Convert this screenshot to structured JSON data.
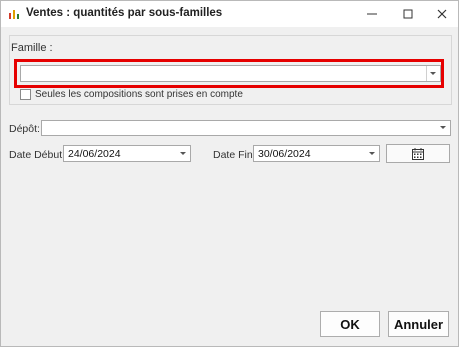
{
  "window": {
    "title": "Ventes : quantités par sous-familles",
    "icon": "bar-chart-icon",
    "controls": [
      "minimize",
      "maximize",
      "close"
    ]
  },
  "famille": {
    "label": "Famille :",
    "value": "",
    "highlight_color": "#e60000"
  },
  "compositions": {
    "label": "Seules les compositions sont prises en compte",
    "checked": false
  },
  "depot": {
    "label": "Dépôt:",
    "value": ""
  },
  "date_debut": {
    "label": "Date Début:",
    "value": "24/06/2024"
  },
  "date_fin": {
    "label": "Date Fin:",
    "value": "30/06/2024"
  },
  "calendar_button": {
    "icon": "calendar-icon"
  },
  "buttons": {
    "ok": "OK",
    "cancel": "Annuler"
  }
}
